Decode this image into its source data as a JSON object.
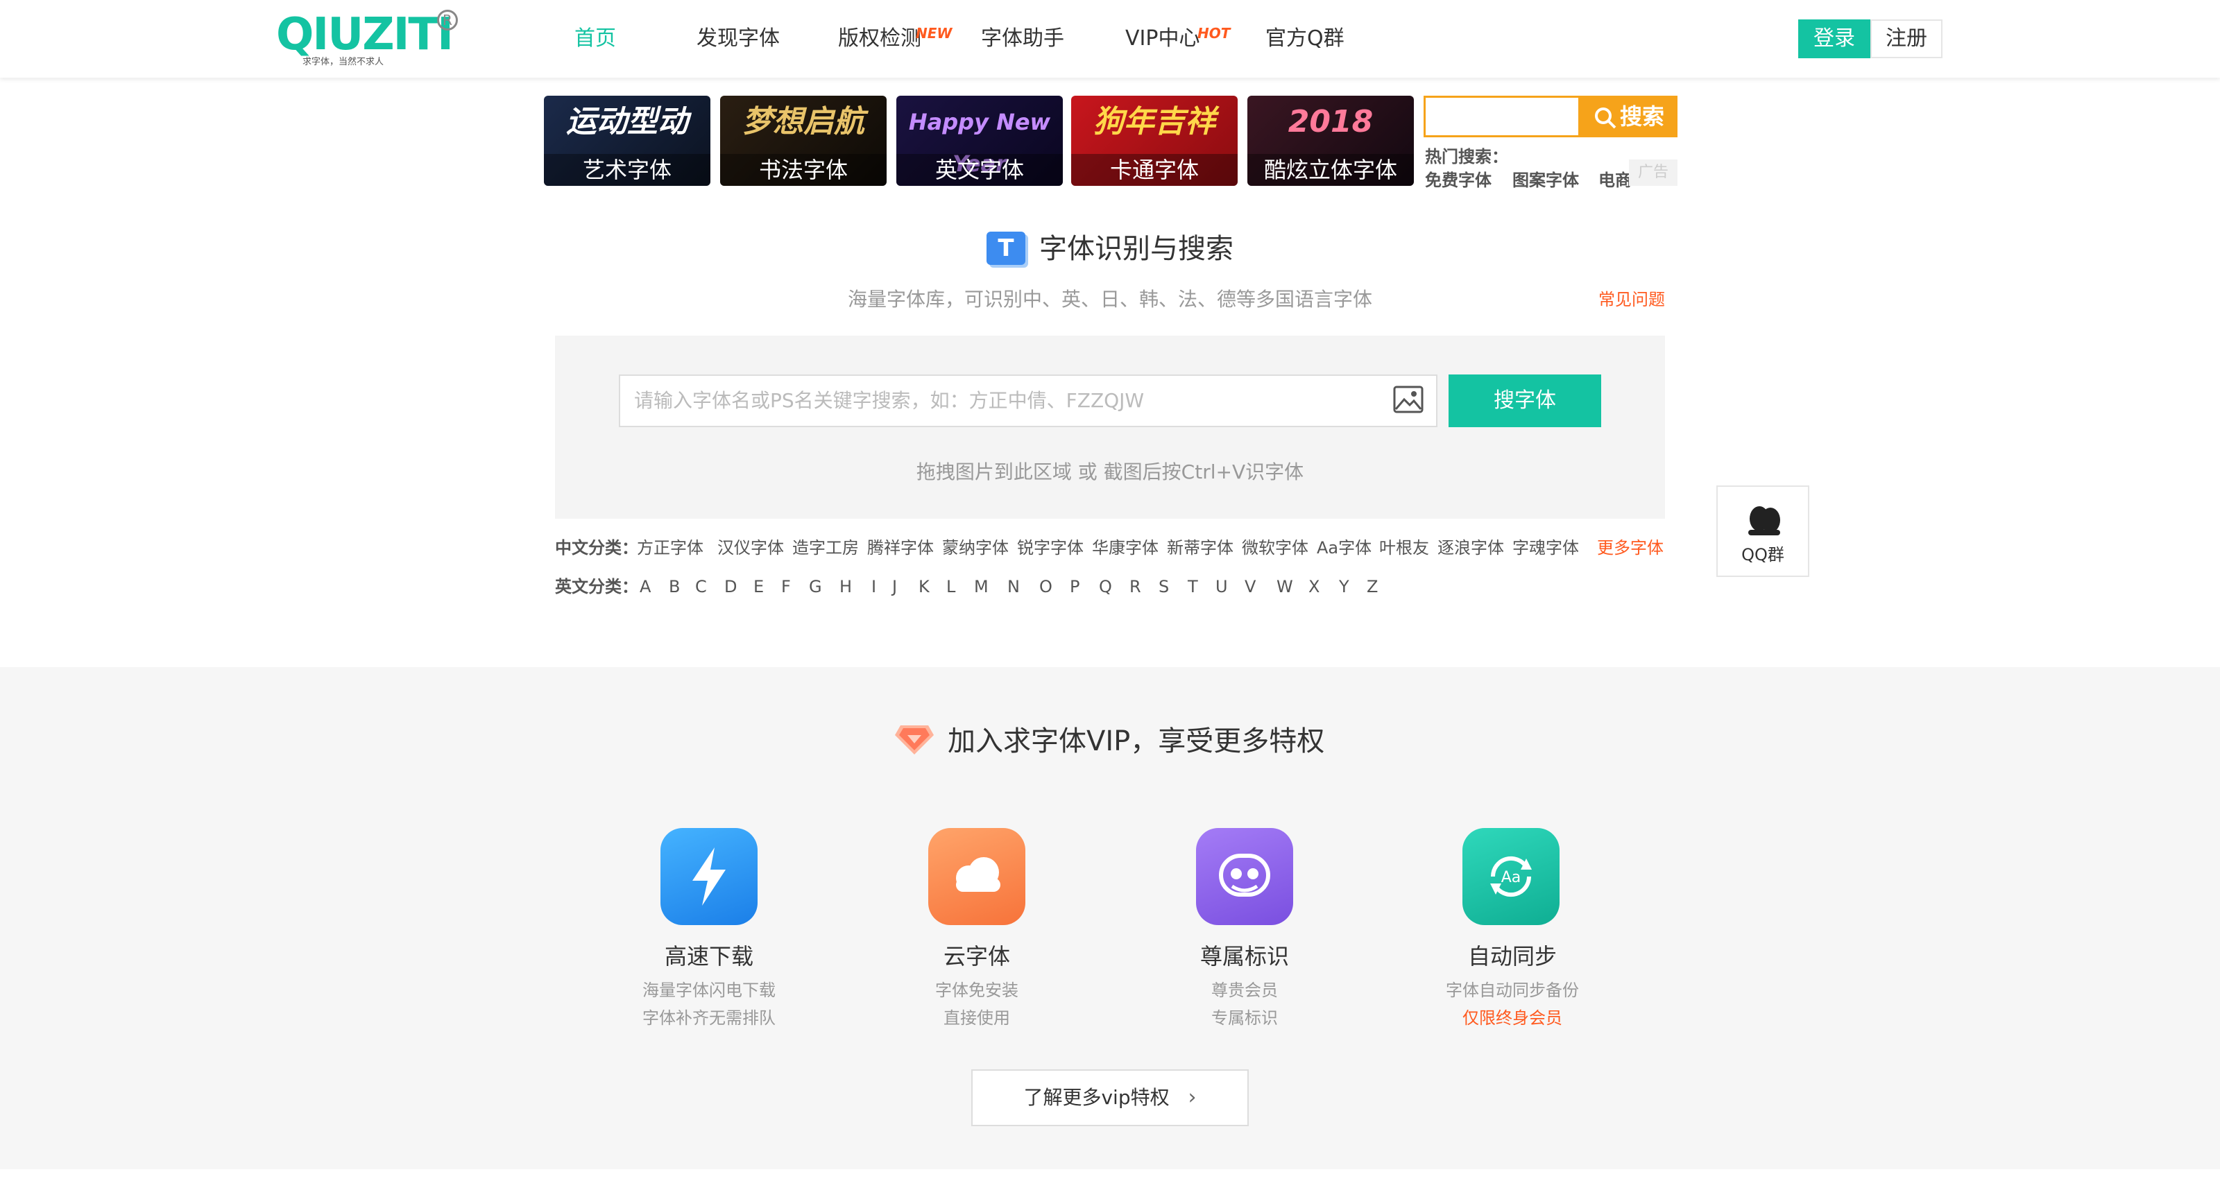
{
  "header": {
    "logo_text": "QIUZITI",
    "logo_slogan": "求字体，当然不求人",
    "nav": [
      {
        "label": "首页",
        "badge": ""
      },
      {
        "label": "发现字体",
        "badge": ""
      },
      {
        "label": "版权检测",
        "badge": "NEW"
      },
      {
        "label": "字体助手",
        "badge": ""
      },
      {
        "label": "VIP中心",
        "badge": "HOT"
      },
      {
        "label": "官方Q群",
        "badge": ""
      }
    ],
    "login": "登录",
    "register": "注册"
  },
  "banners": [
    {
      "art": "运动型动",
      "caption": "艺术字体"
    },
    {
      "art": "梦想启航",
      "caption": "书法字体"
    },
    {
      "art": "Happy New Year",
      "caption": "英文字体"
    },
    {
      "art": "狗年吉祥",
      "caption": "卡通字体"
    },
    {
      "art": "2018",
      "caption": "酷炫立体字体"
    }
  ],
  "banner_search": {
    "button": "搜索",
    "hot_label": "热门搜索：",
    "hot_items": [
      "免费字体",
      "图案字体",
      "电商"
    ],
    "ad_tag": "广告"
  },
  "identify": {
    "icon_letter": "T",
    "title": "字体识别与搜索",
    "subtitle": "海量字体库，可识别中、英、日、韩、法、德等多国语言字体",
    "faq": "常见问题",
    "search_placeholder": "请输入字体名或PS名关键字搜索，如：方正中倩、FZZQJW",
    "search_button": "搜字体",
    "drag_hint": "拖拽图片到此区域 或 截图后按Ctrl+V识字体"
  },
  "categories": {
    "cn_label": "中文分类：",
    "cn_items": [
      "方正字体",
      "汉仪字体",
      "造字工房",
      "腾祥字体",
      "蒙纳字体",
      "锐字字体",
      "华康字体",
      "新蒂字体",
      "微软字体",
      "Aa字体",
      "叶根友",
      "逐浪字体",
      "字魂字体"
    ],
    "more": "更多字体",
    "en_label": "英文分类：",
    "en_items": [
      "A",
      "B",
      "C",
      "D",
      "E",
      "F",
      "G",
      "H",
      "I",
      "J",
      "K",
      "L",
      "M",
      "N",
      "O",
      "P",
      "Q",
      "R",
      "S",
      "T",
      "U",
      "V",
      "W",
      "X",
      "Y",
      "Z"
    ]
  },
  "qq_float": {
    "label": "QQ群"
  },
  "vip": {
    "title": "加入求字体VIP，享受更多特权",
    "features": [
      {
        "name": "高速下载",
        "line1": "海量字体闪电下载",
        "line2": "字体补齐无需排队",
        "color": "#2b95f5",
        "icon": "lightning-icon"
      },
      {
        "name": "云字体",
        "line1": "字体免安装",
        "line2": "直接使用",
        "color": "#fb8a4e",
        "icon": "cloud-icon"
      },
      {
        "name": "尊属标识",
        "line1": "尊贵会员",
        "line2": "专属标识",
        "color": "#8c63e8",
        "icon": "badge-icon"
      },
      {
        "name": "自动同步",
        "line1": "字体自动同步备份",
        "line2": "仅限终身会员",
        "color": "#17c1a8",
        "icon": "sync-icon"
      }
    ],
    "more_button": "了解更多vip特权"
  },
  "colors": {
    "brand": "#14c3a2",
    "accent": "#ff5a1f",
    "search_orange": "#f6a31a"
  }
}
